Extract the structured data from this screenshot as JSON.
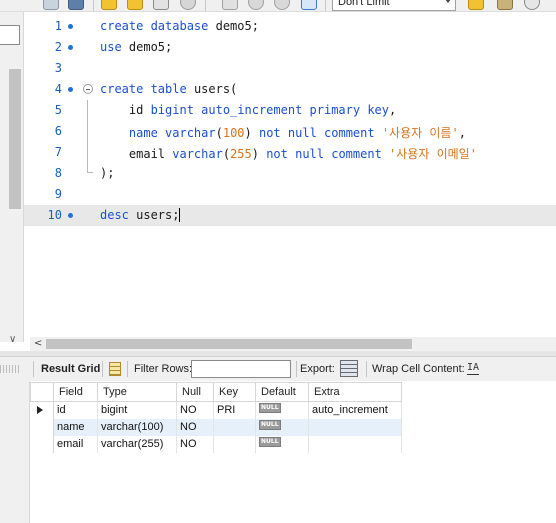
{
  "toolbar": {
    "limit_value": "Don't Limit"
  },
  "editor": {
    "lines": [
      {
        "num": "1",
        "tokens": [
          {
            "t": "create ",
            "c": "kw"
          },
          {
            "t": "database ",
            "c": "kw"
          },
          {
            "t": "demo5;",
            "c": ""
          }
        ]
      },
      {
        "num": "2",
        "tokens": [
          {
            "t": "use ",
            "c": "kw"
          },
          {
            "t": "demo5;",
            "c": ""
          }
        ]
      },
      {
        "num": "3",
        "tokens": []
      },
      {
        "num": "4",
        "tokens": [
          {
            "t": "create ",
            "c": "kw"
          },
          {
            "t": "table ",
            "c": "kw"
          },
          {
            "t": "users(",
            "c": ""
          }
        ]
      },
      {
        "num": "5",
        "tokens": [
          {
            "t": "    id ",
            "c": ""
          },
          {
            "t": "bigint ",
            "c": "kw"
          },
          {
            "t": "auto_increment ",
            "c": "kw"
          },
          {
            "t": "primary ",
            "c": "kw"
          },
          {
            "t": "key",
            "c": "kw"
          },
          {
            "t": ",",
            "c": ""
          }
        ]
      },
      {
        "num": "6",
        "tokens": [
          {
            "t": "    name ",
            "c": "kw"
          },
          {
            "t": "varchar",
            "c": "kw"
          },
          {
            "t": "(",
            "c": ""
          },
          {
            "t": "100",
            "c": "num"
          },
          {
            "t": ") ",
            "c": ""
          },
          {
            "t": "not ",
            "c": "kw"
          },
          {
            "t": "null ",
            "c": "kw"
          },
          {
            "t": "comment ",
            "c": "kw"
          },
          {
            "t": "'사용자 이름'",
            "c": "str"
          },
          {
            "t": ",",
            "c": ""
          }
        ]
      },
      {
        "num": "7",
        "tokens": [
          {
            "t": "    email ",
            "c": ""
          },
          {
            "t": "varchar",
            "c": "kw"
          },
          {
            "t": "(",
            "c": ""
          },
          {
            "t": "255",
            "c": "num"
          },
          {
            "t": ") ",
            "c": ""
          },
          {
            "t": "not ",
            "c": "kw"
          },
          {
            "t": "null ",
            "c": "kw"
          },
          {
            "t": "comment ",
            "c": "kw"
          },
          {
            "t": "'사용자 이메일'",
            "c": "str"
          }
        ]
      },
      {
        "num": "8",
        "tokens": [
          {
            "t": ");",
            "c": ""
          }
        ]
      },
      {
        "num": "9",
        "tokens": []
      },
      {
        "num": "10",
        "tokens": [
          {
            "t": "desc ",
            "c": "kw"
          },
          {
            "t": "users;",
            "c": ""
          }
        ]
      }
    ]
  },
  "result_toolbar": {
    "result_grid_label": "Result Grid",
    "filter_rows_label": "Filter Rows:",
    "filter_rows_value": "",
    "export_label": "Export:",
    "wrap_cell_label": "Wrap Cell Content:",
    "wrap_icon_glyph": "IA"
  },
  "result_grid": {
    "columns": [
      "Field",
      "Type",
      "Null",
      "Key",
      "Default",
      "Extra"
    ],
    "null_badge": "NULL",
    "rows": [
      {
        "field": "id",
        "type": "bigint",
        "null": "NO",
        "key": "PRI",
        "default": "NULL",
        "extra": "auto_increment"
      },
      {
        "field": "name",
        "type": "varchar(100)",
        "null": "NO",
        "key": "",
        "default": "NULL",
        "extra": ""
      },
      {
        "field": "email",
        "type": "varchar(255)",
        "null": "NO",
        "key": "",
        "default": "NULL",
        "extra": ""
      }
    ]
  },
  "colors": {
    "keyword": "#1a4fd0",
    "string": "#d7731a",
    "line_number": "#1a5fb4",
    "active_line": "#e8e8e8",
    "selected_row": "#e6f0fb"
  }
}
